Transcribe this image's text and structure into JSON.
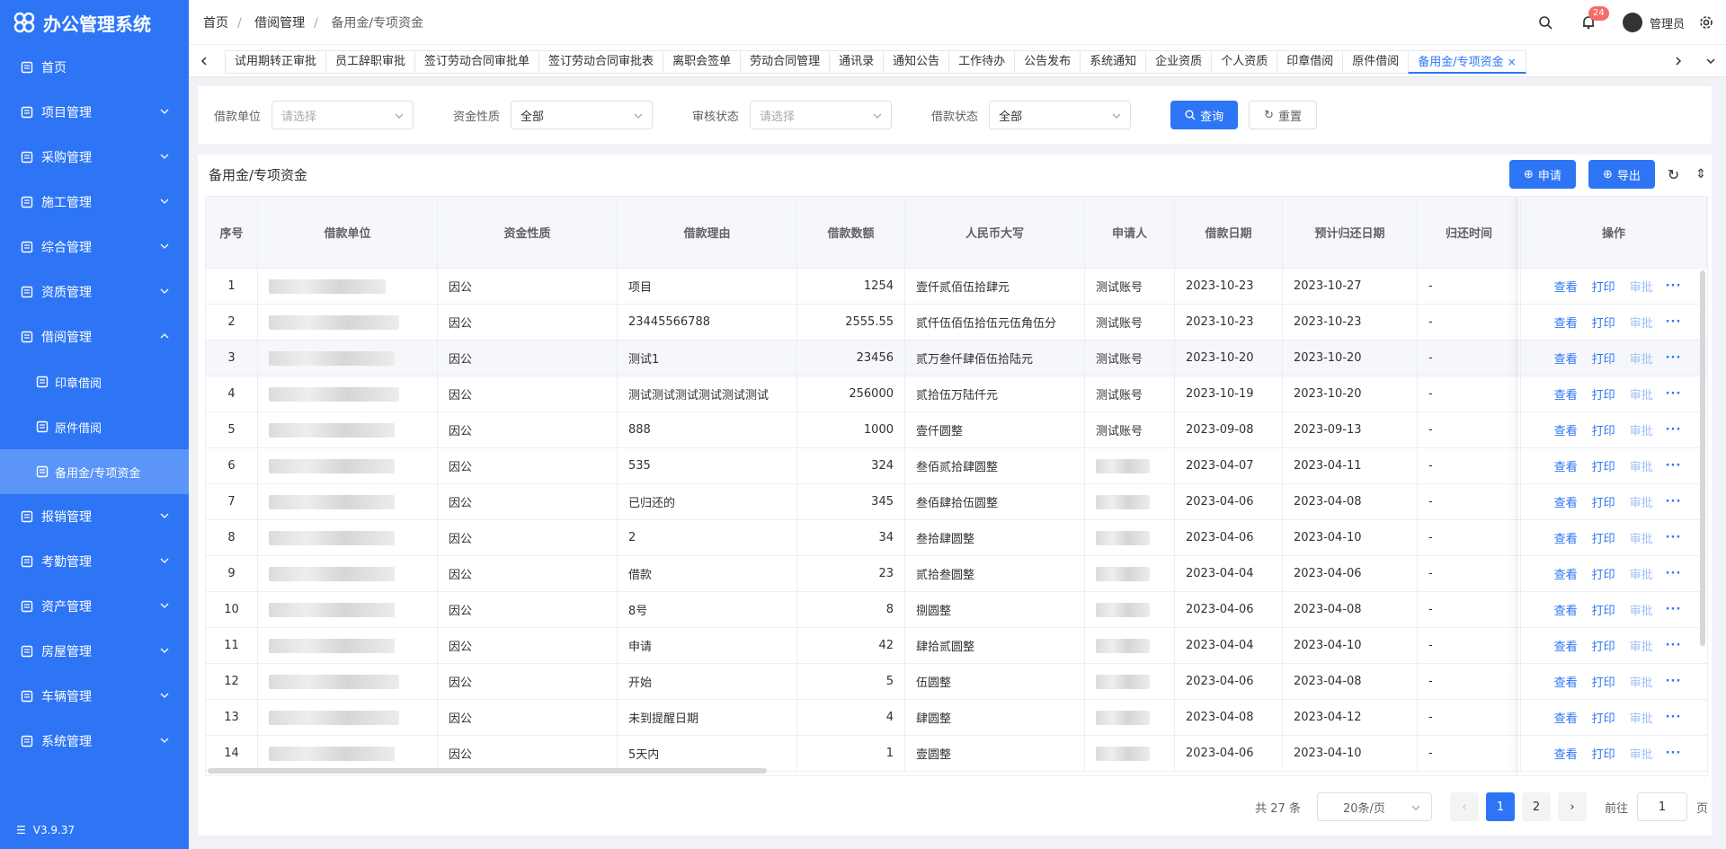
{
  "app": {
    "title": "办公管理系统",
    "version": "V3.9.37"
  },
  "sidebar": {
    "items": [
      {
        "label": "首页",
        "icon": "home-icon"
      },
      {
        "label": "项目管理",
        "icon": "folder-icon"
      },
      {
        "label": "采购管理",
        "icon": "grid-icon"
      },
      {
        "label": "施工管理",
        "icon": "chart-icon"
      },
      {
        "label": "综合管理",
        "icon": "image-icon"
      },
      {
        "label": "资质管理",
        "icon": "certificate-icon"
      },
      {
        "label": "借阅管理",
        "icon": "folder-icon"
      },
      {
        "label": "报销管理",
        "icon": "wallet-icon"
      },
      {
        "label": "考勤管理",
        "icon": "target-icon"
      },
      {
        "label": "资产管理",
        "icon": "box-icon"
      },
      {
        "label": "房屋管理",
        "icon": "building-icon"
      },
      {
        "label": "车辆管理",
        "icon": "car-icon"
      },
      {
        "label": "系统管理",
        "icon": "gear-icon"
      }
    ],
    "sub_items": [
      {
        "label": "印章借阅",
        "icon": "stamp-icon"
      },
      {
        "label": "原件借阅",
        "icon": "document-icon"
      },
      {
        "label": "备用金/专项资金",
        "icon": "money-icon"
      }
    ]
  },
  "header": {
    "breadcrumb": [
      "首页",
      "借阅管理",
      "备用金/专项资金"
    ],
    "notification_count": "24",
    "username": "管理员"
  },
  "tabs": [
    "试用期转正审批",
    "员工辞职审批",
    "签订劳动合同审批单",
    "签订劳动合同审批表",
    "离职会签单",
    "劳动合同管理",
    "通讯录",
    "通知公告",
    "工作待办",
    "公告发布",
    "系统通知",
    "企业资质",
    "个人资质",
    "印章借阅",
    "原件借阅",
    "备用金/专项资金"
  ],
  "filters": [
    {
      "label": "借款单位",
      "value": "请选择",
      "placeholder": true
    },
    {
      "label": "资金性质",
      "value": "全部",
      "placeholder": false
    },
    {
      "label": "审核状态",
      "value": "请选择",
      "placeholder": true
    },
    {
      "label": "借款状态",
      "value": "全部",
      "placeholder": false
    }
  ],
  "buttons": {
    "query": "查询",
    "reset": "重置",
    "apply": "申请",
    "export": "导出"
  },
  "card": {
    "title": "备用金/专项资金"
  },
  "table": {
    "columns": [
      "序号",
      "借款单位",
      "资金性质",
      "借款理由",
      "借款数额",
      "人民币大写",
      "申请人",
      "借款日期",
      "预计归还日期",
      "归还时间",
      "操作"
    ],
    "ops": [
      "查看",
      "打印",
      "审批"
    ],
    "rows": [
      {
        "no": "1",
        "nature": "因公",
        "reason": "项目",
        "amount": "1254",
        "upper": "壹仟贰佰伍拾肆元",
        "applicant": "测试账号",
        "date": "2023-10-23",
        "due": "2023-10-27",
        "returned": "-"
      },
      {
        "no": "2",
        "nature": "因公",
        "reason": "23445566788",
        "amount": "2555.55",
        "upper": "贰仟伍佰伍拾伍元伍角伍分",
        "applicant": "测试账号",
        "date": "2023-10-23",
        "due": "2023-10-23",
        "returned": "-"
      },
      {
        "no": "3",
        "nature": "因公",
        "reason": "测试1",
        "amount": "23456",
        "upper": "贰万叁仟肆佰伍拾陆元",
        "applicant": "测试账号",
        "date": "2023-10-20",
        "due": "2023-10-20",
        "returned": "-"
      },
      {
        "no": "4",
        "nature": "因公",
        "reason": "测试测试测试测试测试测试",
        "amount": "256000",
        "upper": "贰拾伍万陆仟元",
        "applicant": "测试账号",
        "date": "2023-10-19",
        "due": "2023-10-20",
        "returned": "-"
      },
      {
        "no": "5",
        "nature": "因公",
        "reason": "888",
        "amount": "1000",
        "upper": "壹仟圆整",
        "applicant": "测试账号",
        "date": "2023-09-08",
        "due": "2023-09-13",
        "returned": "-"
      },
      {
        "no": "6",
        "nature": "因公",
        "reason": "535",
        "amount": "324",
        "upper": "叁佰贰拾肆圆整",
        "applicant": "",
        "date": "2023-04-07",
        "due": "2023-04-11",
        "returned": "-"
      },
      {
        "no": "7",
        "nature": "因公",
        "reason": "已归还的",
        "amount": "345",
        "upper": "叁佰肆拾伍圆整",
        "applicant": "",
        "date": "2023-04-06",
        "due": "2023-04-08",
        "returned": "-"
      },
      {
        "no": "8",
        "nature": "因公",
        "reason": "2",
        "amount": "34",
        "upper": "叁拾肆圆整",
        "applicant": "",
        "date": "2023-04-06",
        "due": "2023-04-10",
        "returned": "-"
      },
      {
        "no": "9",
        "nature": "因公",
        "reason": "借款",
        "amount": "23",
        "upper": "贰拾叁圆整",
        "applicant": "",
        "date": "2023-04-04",
        "due": "2023-04-06",
        "returned": "-"
      },
      {
        "no": "10",
        "nature": "因公",
        "reason": "8号",
        "amount": "8",
        "upper": "捌圆整",
        "applicant": "",
        "date": "2023-04-06",
        "due": "2023-04-08",
        "returned": "-"
      },
      {
        "no": "11",
        "nature": "因公",
        "reason": "申请",
        "amount": "42",
        "upper": "肆拾贰圆整",
        "applicant": "",
        "date": "2023-04-04",
        "due": "2023-04-10",
        "returned": "-"
      },
      {
        "no": "12",
        "nature": "因公",
        "reason": "开始",
        "amount": "5",
        "upper": "伍圆整",
        "applicant": "",
        "date": "2023-04-06",
        "due": "2023-04-08",
        "returned": "-"
      },
      {
        "no": "13",
        "nature": "因公",
        "reason": "未到提醒日期",
        "amount": "4",
        "upper": "肆圆整",
        "applicant": "",
        "date": "2023-04-08",
        "due": "2023-04-12",
        "returned": "-"
      },
      {
        "no": "14",
        "nature": "因公",
        "reason": "5天内",
        "amount": "1",
        "upper": "壹圆整",
        "applicant": "",
        "date": "2023-04-06",
        "due": "2023-04-10",
        "returned": "-"
      }
    ]
  },
  "pagination": {
    "total": "共 27 条",
    "page_size": "20条/页",
    "pages": [
      "1",
      "2"
    ],
    "goto_label": "前往",
    "goto_value": "1",
    "page_unit": "页"
  },
  "colors": {
    "primary": "#2d75f5",
    "sidebar_active": "#5a95f7",
    "badge": "#f56c6c"
  }
}
